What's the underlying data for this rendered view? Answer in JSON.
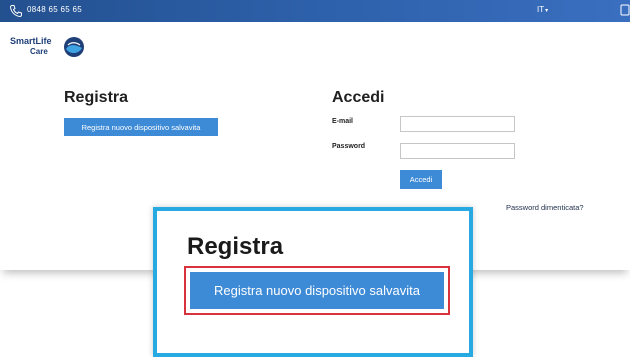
{
  "topbar": {
    "phone_icon": "phone-icon",
    "phone": "0848 65 65 65",
    "language": "IT",
    "language_chevron": "▾",
    "user_icon": "user-icon"
  },
  "logo": {
    "line1": "SmartLife",
    "line2": "Care"
  },
  "register": {
    "title": "Registra",
    "button_label": "Registra nuovo dispositivo salvavita"
  },
  "login": {
    "title": "Accedi",
    "email_label": "E-mail",
    "email_value": "",
    "password_label": "Password",
    "password_value": "",
    "button_label": "Accedi",
    "forgot_link": "Password dimenticata?"
  },
  "zoom": {
    "title": "Registra",
    "button_label": "Registra nuovo dispositivo salvavita"
  },
  "colors": {
    "topbar": "#2c5fa8",
    "button": "#3d8ad6",
    "zoom_border": "#27a9e1",
    "highlight": "#d8333d"
  }
}
